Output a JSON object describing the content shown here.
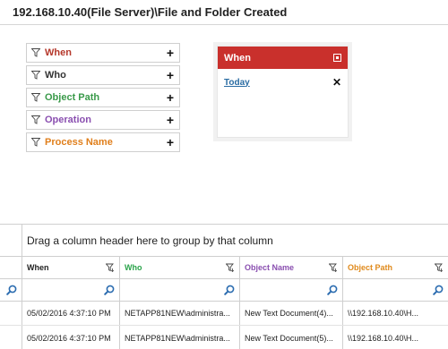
{
  "page": {
    "title": "192.168.10.40(File Server)\\File and Folder Created"
  },
  "filters": [
    {
      "label": "When",
      "color": "#b5382b"
    },
    {
      "label": "Who",
      "color": "#333333"
    },
    {
      "label": "Object Path",
      "color": "#3a9a4a"
    },
    {
      "label": "Operation",
      "color": "#8a4fb0"
    },
    {
      "label": "Process Name",
      "color": "#e07f1c"
    }
  ],
  "when_panel": {
    "header": "When",
    "header_color": "#c9302c",
    "value": "Today"
  },
  "grid": {
    "group_hint": "Drag a column header here to group by that column",
    "columns": [
      {
        "label": "When",
        "color": "#222222"
      },
      {
        "label": "Who",
        "color": "#2aa34a"
      },
      {
        "label": "Object Name",
        "color": "#8a4fb0"
      },
      {
        "label": "Object Path",
        "color": "#e08a1c"
      }
    ],
    "rows": [
      [
        "05/02/2016 4:37:10 PM",
        "NETAPP81NEW\\administra...",
        "New Text Document(4)...",
        "\\\\192.168.10.40\\H..."
      ],
      [
        "05/02/2016 4:37:10 PM",
        "NETAPP81NEW\\administra...",
        "New Text Document(5)...",
        "\\\\192.168.10.40\\H..."
      ]
    ]
  }
}
